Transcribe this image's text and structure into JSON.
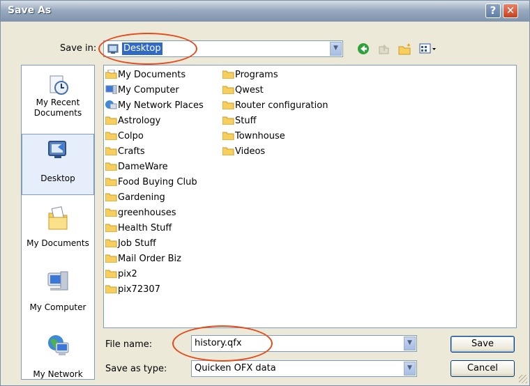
{
  "window": {
    "title": "Save As",
    "help_glyph": "?",
    "close_glyph": "✕"
  },
  "toolbar": {
    "save_in_label": "Save in:",
    "save_in_value": "Desktop",
    "icons": [
      "back-icon",
      "up-one-level-icon",
      "new-folder-icon",
      "view-menu-icon"
    ]
  },
  "places": [
    {
      "label": "My Recent\nDocuments",
      "icon": "recent-documents-icon"
    },
    {
      "label": "Desktop",
      "icon": "desktop-icon",
      "selected": true
    },
    {
      "label": "My Documents",
      "icon": "my-documents-icon"
    },
    {
      "label": "My Computer",
      "icon": "my-computer-icon"
    },
    {
      "label": "My Network",
      "icon": "my-network-icon"
    }
  ],
  "files": {
    "column1": [
      "My Documents",
      "My Computer",
      "My Network Places",
      "Astrology",
      "Colpo",
      "Crafts",
      "DameWare",
      "Food Buying Club",
      "Gardening",
      "greenhouses",
      "Health Stuff",
      "Job Stuff",
      "Mail Order Biz",
      "pix2",
      "pix72307"
    ],
    "column2": [
      "Programs",
      "Qwest",
      "Router configuration",
      "Stuff",
      "Townhouse",
      "Videos"
    ]
  },
  "form": {
    "file_name_label": "File name:",
    "file_name_value": "history.qfx",
    "save_as_type_label": "Save as type:",
    "save_as_type_value": "Quicken OFX data"
  },
  "buttons": {
    "save": "Save",
    "cancel": "Cancel"
  },
  "colors": {
    "highlight_oval": "#e64a19",
    "selection": "#316ac5"
  }
}
